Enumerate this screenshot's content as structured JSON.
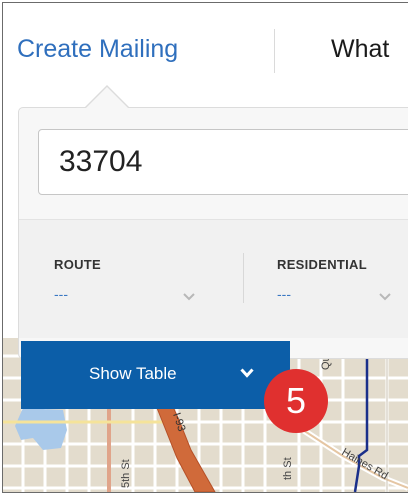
{
  "tabs": {
    "create_mailing": "Create Mailing",
    "what": "What"
  },
  "search": {
    "value": "33704"
  },
  "filters": [
    {
      "label": "ROUTE",
      "value": "---"
    },
    {
      "label": "RESIDENTIAL",
      "value": "---"
    }
  ],
  "show_table": {
    "label": "Show Table",
    "icon": "chevron-down-icon"
  },
  "badge": {
    "number": "5",
    "color": "#e0302f"
  },
  "map": {
    "street_labels": [
      "5th St",
      "I-93",
      "Qu",
      "th St",
      "Haines Rd"
    ]
  },
  "colors": {
    "accent": "#2f6fbd",
    "button": "#0c5ea8"
  }
}
